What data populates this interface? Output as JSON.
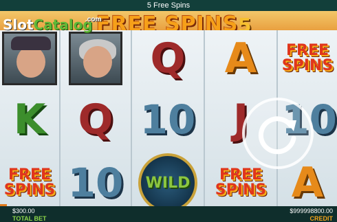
{
  "status_bar": {
    "title": "5 Free Spins"
  },
  "logo": {
    "part1": "Slot",
    "part2": "Catalog",
    "suffix": ".com"
  },
  "banner": {
    "text": "FREE SPINS",
    "count": "5"
  },
  "reels": [
    [
      "portrait-man",
      "K",
      "FREE SPINS"
    ],
    [
      "portrait-queen",
      "Q",
      "10"
    ],
    [
      "Q",
      "10",
      "WILD"
    ],
    [
      "A",
      "J",
      "FREE SPINS"
    ],
    [
      "FREE SPINS",
      "10",
      "A"
    ]
  ],
  "symbols": {
    "K": "K",
    "Q": "Q",
    "A": "A",
    "J": "J",
    "ten": "10",
    "wild": "WILD",
    "free_line1": "FREE",
    "free_line2": "SPINS"
  },
  "footer": {
    "total_bet_value": "$300.00",
    "total_bet_label": "TOTAL BET",
    "credit_value": "$999998800.00",
    "credit_label": "CREDIT"
  },
  "icons": {
    "spin": "refresh-icon"
  },
  "colors": {
    "bar_bg": "#0f2e2c",
    "accent_green": "#8cd64a",
    "accent_orange": "#f2a31a"
  }
}
